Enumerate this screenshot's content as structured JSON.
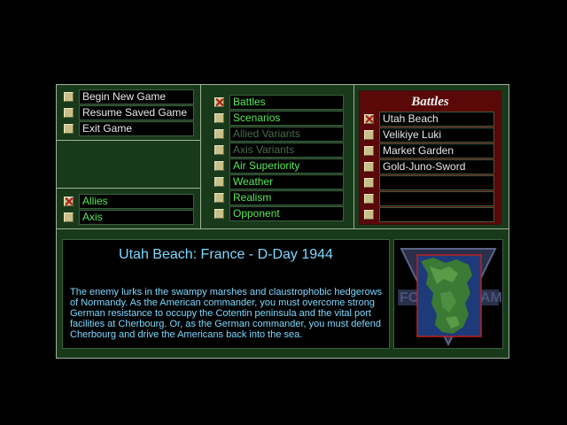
{
  "main_menu": [
    {
      "label": "Begin New Game"
    },
    {
      "label": "Resume Saved Game"
    },
    {
      "label": "Exit Game"
    }
  ],
  "sides": [
    {
      "label": "Allies",
      "checked": true
    },
    {
      "label": "Axis",
      "checked": false
    }
  ],
  "options": [
    {
      "label": "Battles",
      "checked": true,
      "enabled": true
    },
    {
      "label": "Scenarios",
      "checked": false,
      "enabled": true
    },
    {
      "label": "Allied Variants",
      "checked": false,
      "enabled": false
    },
    {
      "label": "Axis Variants",
      "checked": false,
      "enabled": false
    },
    {
      "label": "Air Superiority",
      "checked": false,
      "enabled": true
    },
    {
      "label": "Weather",
      "checked": false,
      "enabled": true
    },
    {
      "label": "Realism",
      "checked": false,
      "enabled": true
    },
    {
      "label": "Opponent",
      "checked": false,
      "enabled": true
    }
  ],
  "battles_panel": {
    "title": "Battles",
    "items": [
      {
        "label": "Utah Beach",
        "checked": true
      },
      {
        "label": "Velikiye Luki",
        "checked": false
      },
      {
        "label": "Market Garden",
        "checked": false
      },
      {
        "label": "Gold-Juno-Sword",
        "checked": false
      },
      {
        "label": "",
        "checked": false
      },
      {
        "label": "",
        "checked": false
      },
      {
        "label": "",
        "checked": false
      }
    ]
  },
  "scenario": {
    "title": "Utah Beach: France - D-Day 1944",
    "description": "The enemy lurks in the swampy marshes and claustrophobic hedgerows of Normandy.  As the American commander, you must overcome strong German resistance to occupy the Cotentin peninsula and the vital port facilities at Cherbourg.  Or, as the German commander, you must defend Cherbourg and drive the Americans back into the sea."
  },
  "logo": {
    "text": "FORTRESS AMERICA"
  },
  "colors": {
    "frame_green": "#183a1b",
    "label_green": "#58ea58",
    "battles_red": "#5a0808",
    "desc_cyan": "#7fd8ff"
  }
}
